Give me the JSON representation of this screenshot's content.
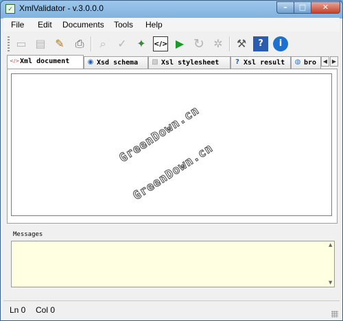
{
  "window": {
    "title": "XmlValidator - v.3.0.0.0"
  },
  "menu": [
    "File",
    "Edit",
    "Documents",
    "Tools",
    "Help"
  ],
  "toolbar": [
    {
      "name": "new",
      "icon": "eraser-icon",
      "glyph": "▭",
      "enabled": false
    },
    {
      "name": "save",
      "icon": "floppy-icon",
      "glyph": "▤",
      "enabled": false
    },
    {
      "name": "edit",
      "icon": "edit-icon",
      "glyph": "✎",
      "enabled": true
    },
    {
      "name": "print",
      "icon": "printer-icon",
      "glyph": "⎙",
      "enabled": false
    },
    {
      "name": "find",
      "icon": "binoculars-icon",
      "glyph": "⌕",
      "enabled": false
    },
    {
      "name": "spellcheck",
      "icon": "abc-check-icon",
      "glyph": "✓",
      "enabled": false
    },
    {
      "name": "validate",
      "icon": "wand-icon",
      "glyph": "✦",
      "enabled": true
    },
    {
      "name": "xml-view",
      "icon": "code-icon",
      "glyph": "</>",
      "enabled": true
    },
    {
      "name": "run",
      "icon": "play-icon",
      "glyph": "▶",
      "enabled": true
    },
    {
      "name": "refresh",
      "icon": "refresh-icon",
      "glyph": "↻",
      "enabled": false
    },
    {
      "name": "settings",
      "icon": "gear-icon",
      "glyph": "✲",
      "enabled": false
    },
    {
      "name": "tools",
      "icon": "wrench-icon",
      "glyph": "⚒",
      "enabled": true
    },
    {
      "name": "help-book",
      "icon": "help-book-icon",
      "glyph": "?",
      "enabled": true
    },
    {
      "name": "about",
      "icon": "info-icon",
      "glyph": "i",
      "enabled": true
    }
  ],
  "tabs": [
    {
      "label": "Xml document",
      "icon": "xml-file-icon",
      "glyph": "</>",
      "active": true
    },
    {
      "label": "Xsd schema",
      "icon": "schema-icon",
      "glyph": "◉",
      "active": false
    },
    {
      "label": "Xsl stylesheet",
      "icon": "stylesheet-icon",
      "glyph": "▧",
      "active": false
    },
    {
      "label": "Xsl result",
      "icon": "question-icon",
      "glyph": "?",
      "active": false
    },
    {
      "label": "bro",
      "icon": "globe-icon",
      "glyph": "◍",
      "active": false
    }
  ],
  "watermark": [
    "GreenDown.cn",
    "GreenDown.cn"
  ],
  "messages": {
    "label": "Messages"
  },
  "status": {
    "line": "Ln 0",
    "col": "Col 0"
  },
  "colors": {
    "messages_bg": "#ffffe1",
    "run": "#1a9a2a",
    "info": "#1d6fd0"
  }
}
